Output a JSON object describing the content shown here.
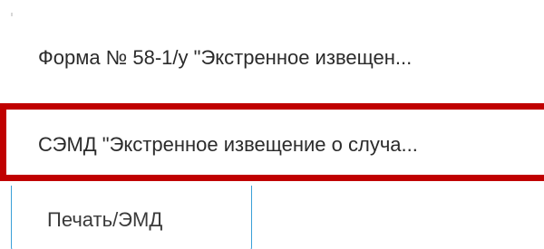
{
  "dropdown": {
    "items": [
      {
        "label": "Форма № 58-1/у \"Экстренное извещен..."
      },
      {
        "label": "СЭМД \"Экстренное извещение о случа..."
      }
    ]
  },
  "print_button": {
    "label": "Печать/ЭМД"
  },
  "colors": {
    "highlight_border": "#c00000",
    "button_border": "#3aa0d8"
  }
}
